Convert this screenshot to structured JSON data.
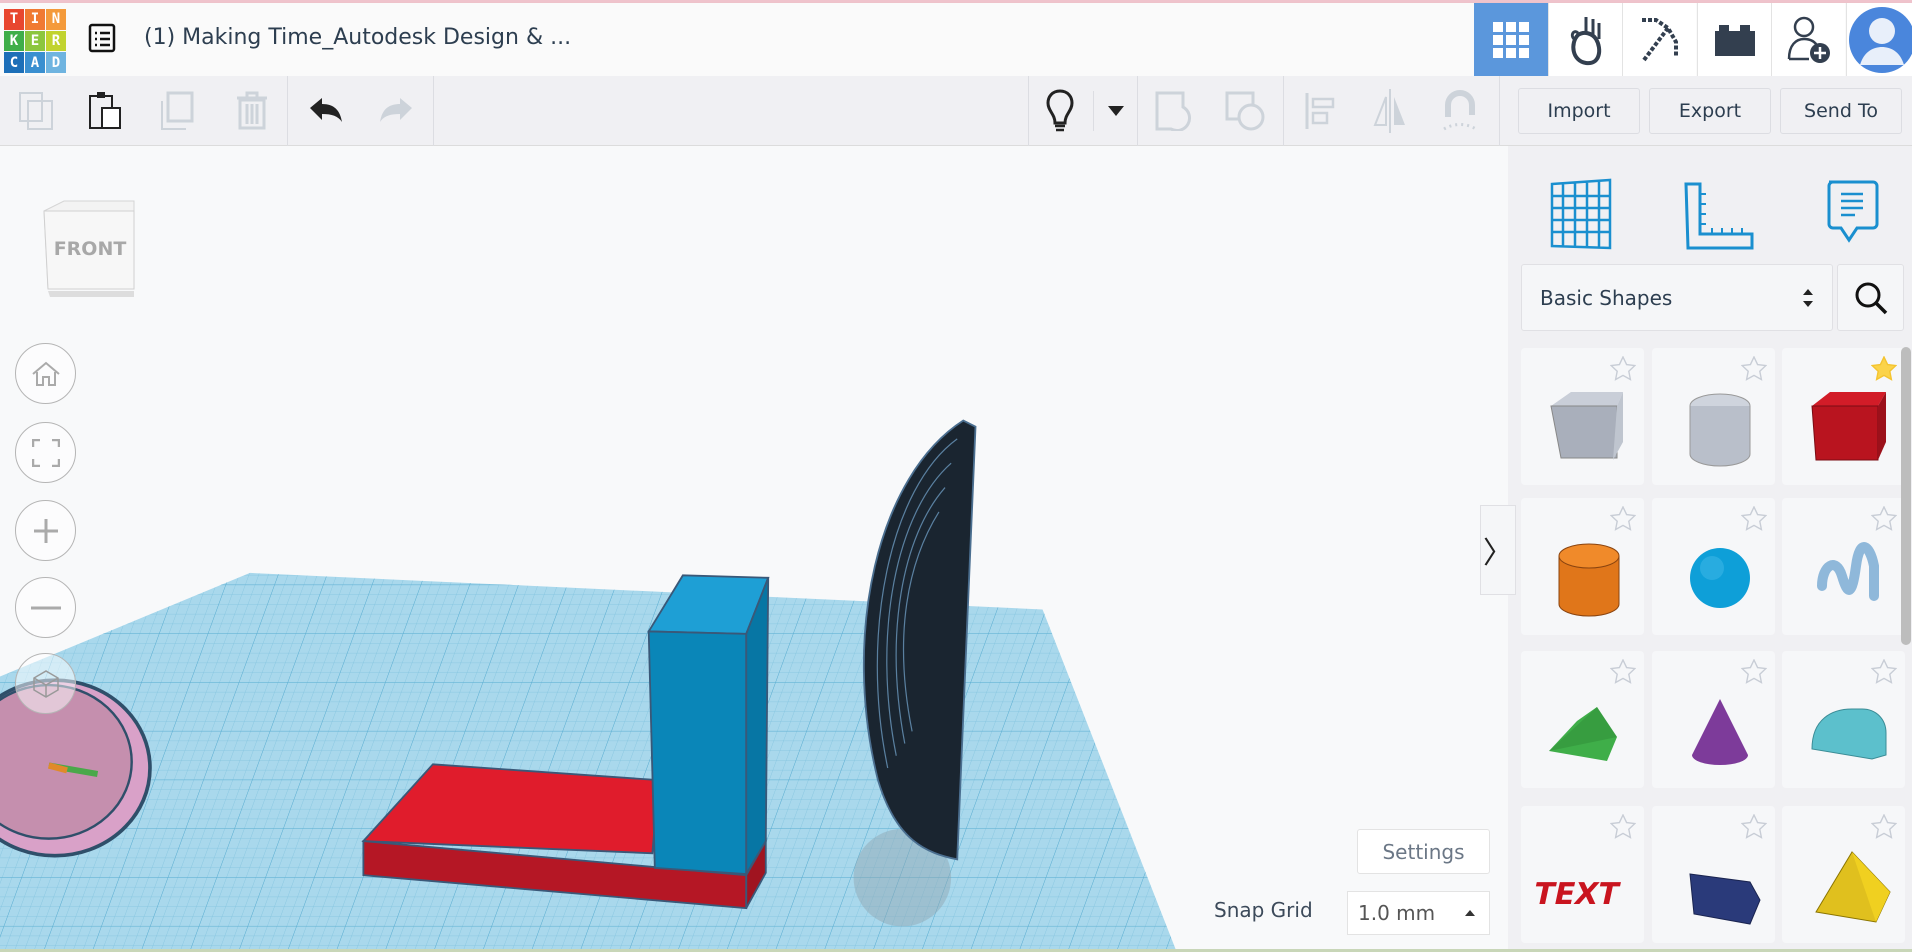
{
  "header": {
    "logo_letters": [
      "T",
      "I",
      "N",
      "K",
      "E",
      "R",
      "C",
      "A",
      "D"
    ],
    "logo_colors": [
      "#e8472f",
      "#f07a32",
      "#f49a3a",
      "#3fae49",
      "#8cc63f",
      "#c1d32f",
      "#1d6fb8",
      "#3a8fd0",
      "#6fb4e0"
    ],
    "title": "(1) Making Time_Autodesk Design & ...",
    "nav": [
      {
        "name": "3d-design",
        "icon": "grid-icon",
        "active": true
      },
      {
        "name": "circuits",
        "icon": "hand-icon"
      },
      {
        "name": "minecraft",
        "icon": "pickaxe-icon"
      },
      {
        "name": "lego",
        "icon": "brick-icon"
      },
      {
        "name": "invite",
        "icon": "user-add-icon"
      },
      {
        "name": "profile",
        "icon": "avatar-icon"
      }
    ],
    "accent": "#5b97dc"
  },
  "toolbar": {
    "tools": [
      "copy-icon",
      "paste-icon",
      "duplicate-icon",
      "delete-icon",
      "undo-icon",
      "redo-icon",
      "lightbulb-icon",
      "dropdown-icon",
      "group-icon",
      "ungroup-icon",
      "align-icon",
      "mirror-icon",
      "magnet-icon"
    ],
    "import_label": "Import",
    "export_label": "Export",
    "send_to_label": "Send To"
  },
  "panel": {
    "icons": [
      "workplane-icon",
      "ruler-icon",
      "notes-icon"
    ],
    "category": "Basic Shapes",
    "shapes": [
      {
        "name": "box-hole",
        "favorite": false
      },
      {
        "name": "cylinder-hole",
        "favorite": false
      },
      {
        "name": "box",
        "favorite": true
      },
      {
        "name": "cylinder",
        "favorite": false
      },
      {
        "name": "sphere",
        "favorite": false
      },
      {
        "name": "scribble",
        "favorite": false
      },
      {
        "name": "roof",
        "favorite": false
      },
      {
        "name": "cone",
        "favorite": false
      },
      {
        "name": "round-roof",
        "favorite": false
      },
      {
        "name": "text",
        "favorite": false,
        "label": "TEXT"
      },
      {
        "name": "polygon",
        "favorite": false
      },
      {
        "name": "pyramid",
        "favorite": false
      }
    ]
  },
  "viewport": {
    "view_cube_label": "FRONT",
    "settings_label": "Settings",
    "snap_grid_label": "Snap Grid",
    "snap_grid_value": "1.0 mm"
  }
}
